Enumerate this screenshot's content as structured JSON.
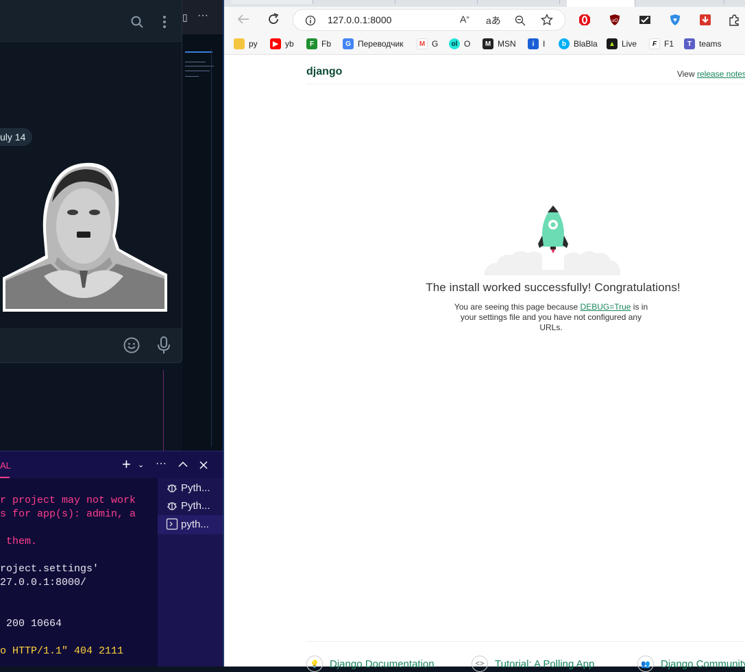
{
  "telegram": {
    "date_badge": "uly 14",
    "header_icons": [
      "search-icon",
      "more-vertical-icon"
    ],
    "input_icons": [
      "emoji-icon",
      "microphone-icon"
    ]
  },
  "vscode": {
    "panel_label": "AL",
    "toolbar_icons": [
      "add-icon",
      "chevron-down-icon",
      "more-icon",
      "chevron-up-icon",
      "close-icon"
    ],
    "terminal_lines": [
      {
        "text": "r project may not work",
        "style": "pink"
      },
      {
        "text": "s for app(s): admin, a",
        "style": "pink"
      },
      {
        "text": "",
        "style": "normal"
      },
      {
        "text": " them.",
        "style": "pink"
      },
      {
        "text": "",
        "style": "normal"
      },
      {
        "text": "roject.settings'",
        "style": "normal"
      },
      {
        "text": "27.0.0.1:8000/",
        "style": "normal"
      },
      {
        "text": "",
        "style": "normal"
      },
      {
        "text": "",
        "style": "normal"
      },
      {
        "text": " 200 10664",
        "style": "normal"
      },
      {
        "text": "",
        "style": "normal"
      },
      {
        "text": "o HTTP/1.1\" 404 2111",
        "style": "yellow"
      }
    ],
    "terminal_list": [
      {
        "label": "Pyth...",
        "icon": "debug-icon"
      },
      {
        "label": "Pyth...",
        "icon": "debug-icon"
      },
      {
        "label": "pyth...",
        "icon": "terminal-icon"
      }
    ]
  },
  "browser": {
    "url": "127.0.0.1:8000",
    "bookmarks": [
      {
        "label": "py",
        "icon": "folder-icon",
        "color": "#f5c542"
      },
      {
        "label": "yb",
        "icon": "youtube-icon",
        "color": "#ff0000"
      },
      {
        "label": "Fb",
        "icon": "fb-icon",
        "color": "#1f8f2f"
      },
      {
        "label": "Переводчик",
        "icon": "translate-icon",
        "color": "#4285f4"
      },
      {
        "label": "G",
        "icon": "gmail-icon",
        "color": "#ea4335"
      },
      {
        "label": "O",
        "icon": "olx-icon",
        "color": "#23e5db"
      },
      {
        "label": "MSN",
        "icon": "msn-icon",
        "color": "#222222"
      },
      {
        "label": "I",
        "icon": "info-icon",
        "color": "#1a5fd6"
      },
      {
        "label": "BlaBla",
        "icon": "blabla-icon",
        "color": "#00aff5"
      },
      {
        "label": "Live",
        "icon": "live-icon",
        "color": "#1a1a1a"
      },
      {
        "label": "F1",
        "icon": "f1-icon",
        "color": "#111111"
      },
      {
        "label": "teams",
        "icon": "teams-icon",
        "color": "#5b5fc7"
      }
    ]
  },
  "django": {
    "logo": "django",
    "release_prefix": "View ",
    "release_link": "release notes",
    "title": "The install worked successfully! Congratulations!",
    "sub_before": "You are seeing this page because ",
    "sub_link": "DEBUG=True",
    "sub_after": " is in your settings file and you have not configured any URLs.",
    "footer": [
      {
        "label": "Django Documentation",
        "icon": "bulb-icon"
      },
      {
        "label": "Tutorial: A Polling App",
        "icon": "code-icon"
      },
      {
        "label": "Django Community",
        "icon": "people-icon"
      }
    ],
    "colors": {
      "brand": "#0c4b33",
      "link": "#19865c",
      "rocket": "#6cdcb4"
    }
  }
}
